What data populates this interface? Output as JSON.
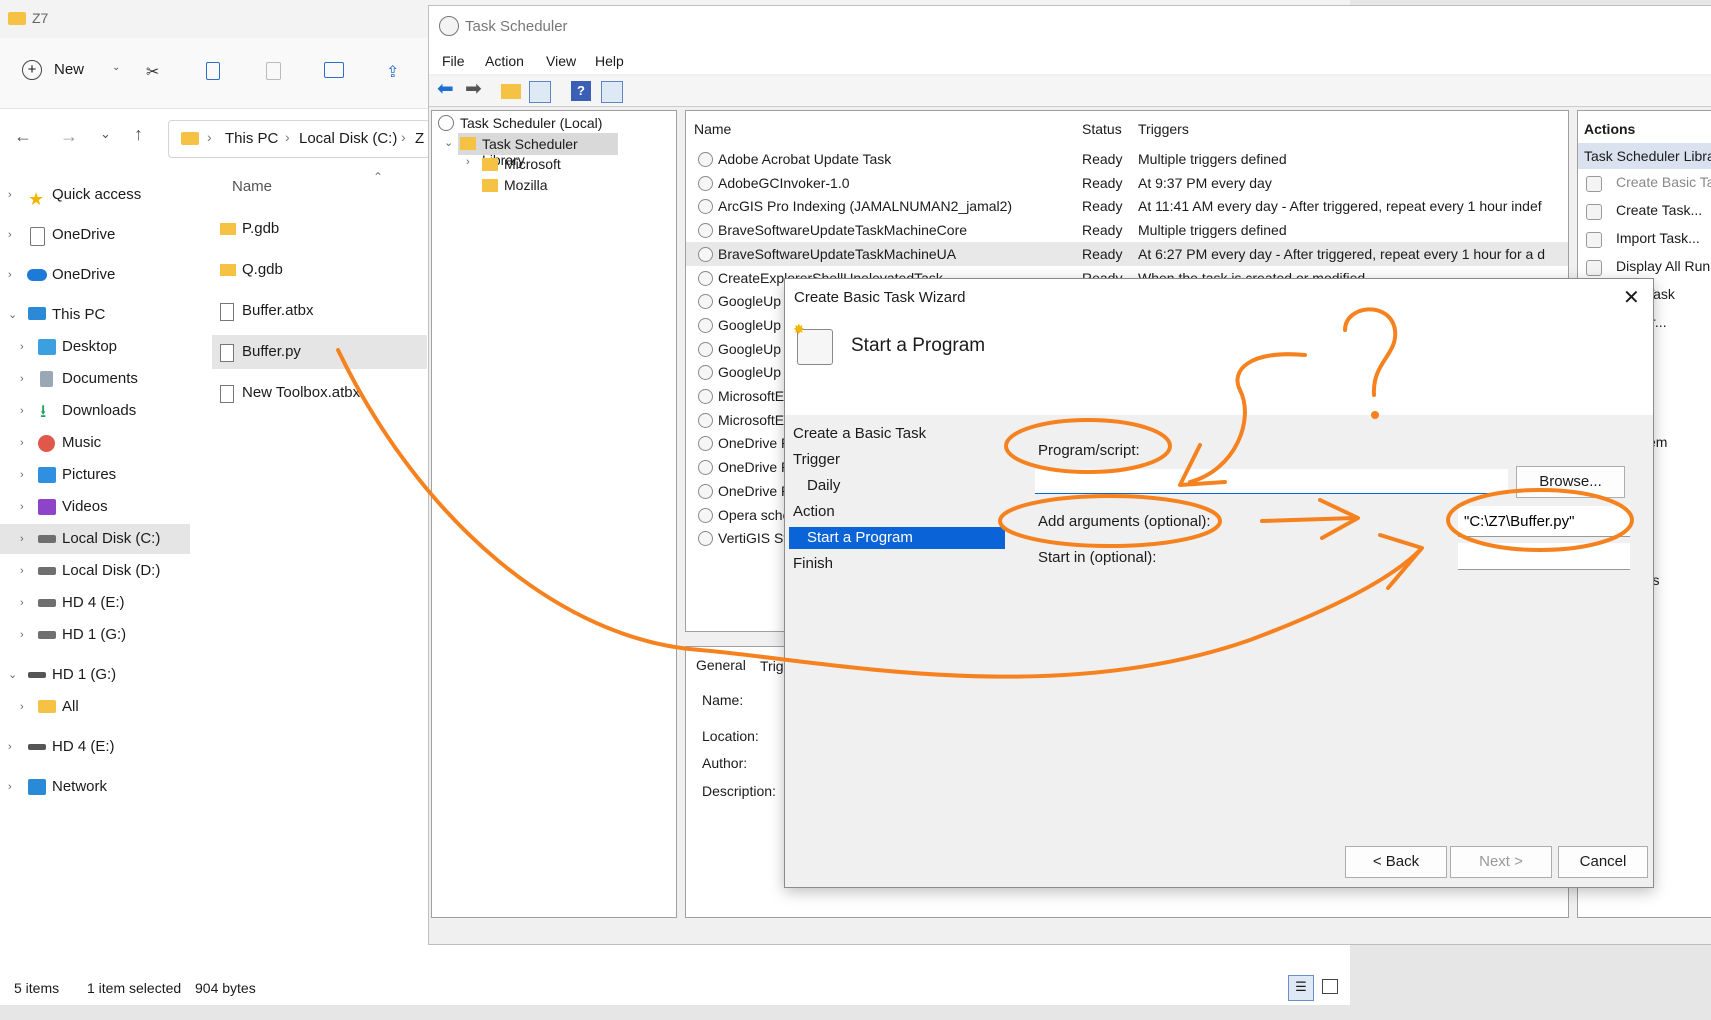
{
  "explorer": {
    "title": "Z7",
    "toolbar": {
      "new_label": "New"
    },
    "address": {
      "parts": [
        "This PC",
        "Local Disk (C:)",
        "Z"
      ]
    },
    "column_header": "Name",
    "nav": [
      {
        "label": "Quick access",
        "icon": "star-icon"
      },
      {
        "label": "OneDrive",
        "icon": "document-icon"
      },
      {
        "label": "OneDrive",
        "icon": "cloud-icon"
      },
      {
        "label": "This PC",
        "icon": "computer-icon"
      },
      {
        "label": "Desktop",
        "icon": "desktop-icon"
      },
      {
        "label": "Documents",
        "icon": "documents-icon"
      },
      {
        "label": "Downloads",
        "icon": "download-icon"
      },
      {
        "label": "Music",
        "icon": "music-icon"
      },
      {
        "label": "Pictures",
        "icon": "pictures-icon"
      },
      {
        "label": "Videos",
        "icon": "videos-icon"
      },
      {
        "label": "Local Disk (C:)",
        "icon": "drive-icon"
      },
      {
        "label": "Local Disk (D:)",
        "icon": "drive-icon"
      },
      {
        "label": "HD 4 (E:)",
        "icon": "drive-icon"
      },
      {
        "label": "HD 1 (G:)",
        "icon": "drive-icon"
      },
      {
        "label": "HD 1 (G:)",
        "icon": "drive-icon"
      },
      {
        "label": "All",
        "icon": "folder-icon"
      },
      {
        "label": "HD 4 (E:)",
        "icon": "drive-icon"
      },
      {
        "label": "Network",
        "icon": "network-icon"
      }
    ],
    "files": [
      {
        "label": "P.gdb",
        "icon": "folder-icon"
      },
      {
        "label": "Q.gdb",
        "icon": "folder-icon"
      },
      {
        "label": "Buffer.atbx",
        "icon": "file-icon"
      },
      {
        "label": "Buffer.py",
        "icon": "file-icon"
      },
      {
        "label": "New Toolbox.atbx",
        "icon": "file-icon"
      }
    ],
    "status": {
      "items": "5 items",
      "selected": "1 item selected",
      "size": "904 bytes"
    }
  },
  "task_scheduler": {
    "title": "Task Scheduler",
    "menu": [
      "File",
      "Action",
      "View",
      "Help"
    ],
    "tree": [
      "Task Scheduler (Local)",
      "Task Scheduler Library",
      "Microsoft",
      "Mozilla"
    ],
    "columns": [
      "Name",
      "Status",
      "Triggers"
    ],
    "tasks": [
      {
        "name": "Adobe Acrobat Update Task",
        "status": "Ready",
        "trigger": "Multiple triggers defined"
      },
      {
        "name": "AdobeGCInvoker-1.0",
        "status": "Ready",
        "trigger": "At 9:37 PM every day"
      },
      {
        "name": "ArcGIS Pro Indexing (JAMALNUMAN2_jamal2)",
        "status": "Ready",
        "trigger": "At 11:41 AM every day - After triggered, repeat every 1 hour indef"
      },
      {
        "name": "BraveSoftwareUpdateTaskMachineCore",
        "status": "Ready",
        "trigger": "Multiple triggers defined"
      },
      {
        "name": "BraveSoftwareUpdateTaskMachineUA",
        "status": "Ready",
        "trigger": "At 6:27 PM every day - After triggered, repeat every 1 hour for a d"
      },
      {
        "name": "CreateExplorerShellUnelevatedTask",
        "status": "Ready",
        "trigger": "When the task is created or modified"
      },
      {
        "name": "GoogleUp",
        "status": "",
        "trigger": ""
      },
      {
        "name": "GoogleUp",
        "status": "",
        "trigger": ""
      },
      {
        "name": "GoogleUp",
        "status": "",
        "trigger": ""
      },
      {
        "name": "GoogleUp",
        "status": "",
        "trigger": ""
      },
      {
        "name": "MicrosoftE",
        "status": "",
        "trigger": ""
      },
      {
        "name": "MicrosoftE",
        "status": "",
        "trigger": ""
      },
      {
        "name": "OneDrive R",
        "status": "",
        "trigger": ""
      },
      {
        "name": "OneDrive R",
        "status": "",
        "trigger": ""
      },
      {
        "name": "OneDrive R",
        "status": "",
        "trigger": ""
      },
      {
        "name": "Opera sche",
        "status": "",
        "trigger": ""
      },
      {
        "name": "VertiGIS St",
        "status": "",
        "trigger": ""
      }
    ],
    "detail_tabs": [
      "General",
      "Trig"
    ],
    "detail_labels": [
      "Name:",
      "Location:",
      "Author:",
      "Description:"
    ],
    "actions_header": "Actions",
    "actions_section": "Task Scheduler Libra",
    "actions": [
      "Create Basic Ta",
      "Create Task...",
      "Import Task...",
      "Display All Run",
      "e All Task",
      "Folder...",
      "h",
      "em",
      "le",
      "t...",
      "rties",
      "e"
    ]
  },
  "wizard": {
    "title": "Create Basic Task Wizard",
    "heading": "Start a Program",
    "steps": [
      "Create a Basic Task",
      "Trigger",
      "Daily",
      "Action",
      "Start a Program",
      "Finish"
    ],
    "program_label": "Program/script:",
    "program_value": "",
    "browse_label": "Browse...",
    "args_label": "Add arguments (optional):",
    "args_value": "\"C:\\Z7\\Buffer.py\"",
    "startin_label": "Start in (optional):",
    "startin_value": "",
    "back_label": "< Back",
    "next_label": "Next >",
    "cancel_label": "Cancel"
  },
  "annotation": {
    "question_mark": "?",
    "color": "#f5821f"
  }
}
